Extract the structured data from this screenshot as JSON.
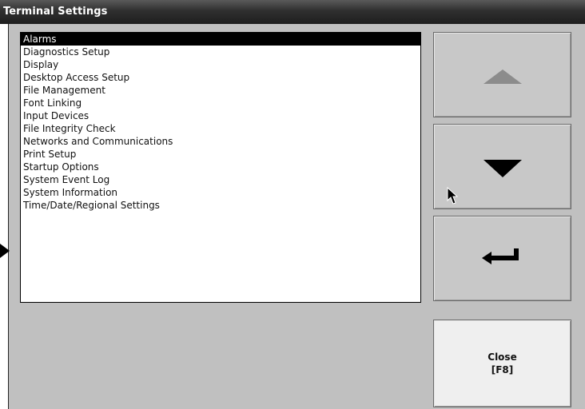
{
  "window": {
    "title": "Terminal Settings"
  },
  "list": {
    "items": [
      "Alarms",
      "Diagnostics Setup",
      "Display",
      "Desktop Access Setup",
      "File Management",
      "Font Linking",
      "Input Devices",
      "File Integrity Check",
      "Networks and Communications",
      "Print Setup",
      "Startup Options",
      "System Event Log",
      "System Information",
      "Time/Date/Regional Settings"
    ],
    "selected_index": 0
  },
  "buttons": {
    "up_icon": "triangle-up-icon",
    "down_icon": "triangle-down-icon",
    "enter_icon": "enter-arrow-icon",
    "close_line1": "Close",
    "close_line2": "[F8]"
  },
  "colors": {
    "title_bar": "#2f2f2f",
    "panel": "#c0c0c0",
    "selection": "#000000"
  }
}
